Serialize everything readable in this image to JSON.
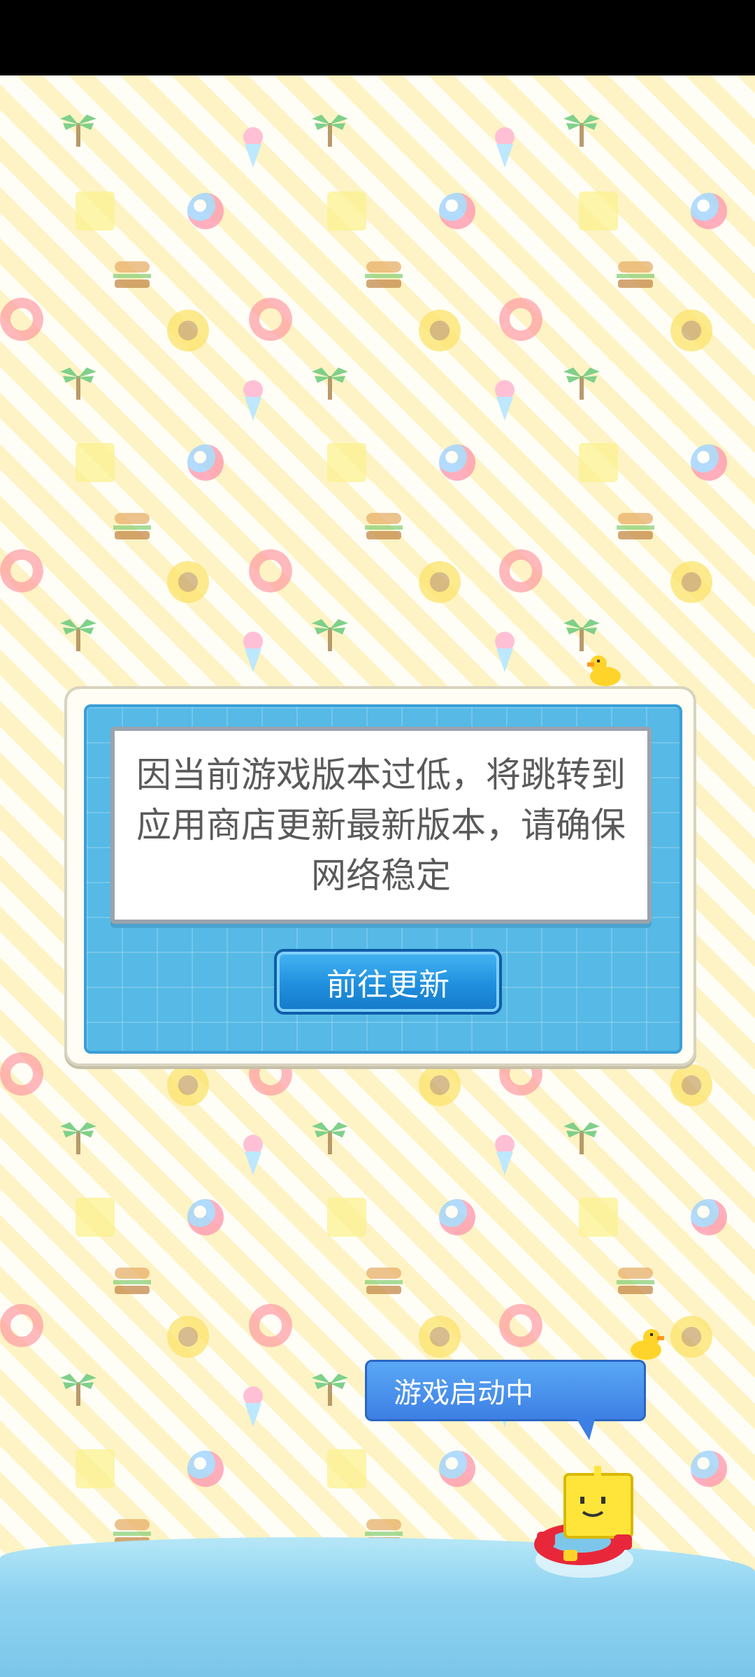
{
  "dialog": {
    "message": "因当前游戏版本过低，将跳转到应用商店更新最新版本，请确保网络稳定",
    "button_label": "前往更新"
  },
  "loading": {
    "text": "游戏启动中"
  },
  "colors": {
    "status_bar": "#000000",
    "panel_blue": "#56b9e6",
    "button_blue": "#1f8fde",
    "bubble_blue": "#3d7fe4"
  },
  "icons": [
    "duck-icon",
    "palm-tree-icon",
    "ice-cream-icon",
    "beach-ball-icon",
    "burger-icon",
    "sunflower-icon",
    "life-ring-icon",
    "cube-face-icon",
    "mascot-character"
  ]
}
